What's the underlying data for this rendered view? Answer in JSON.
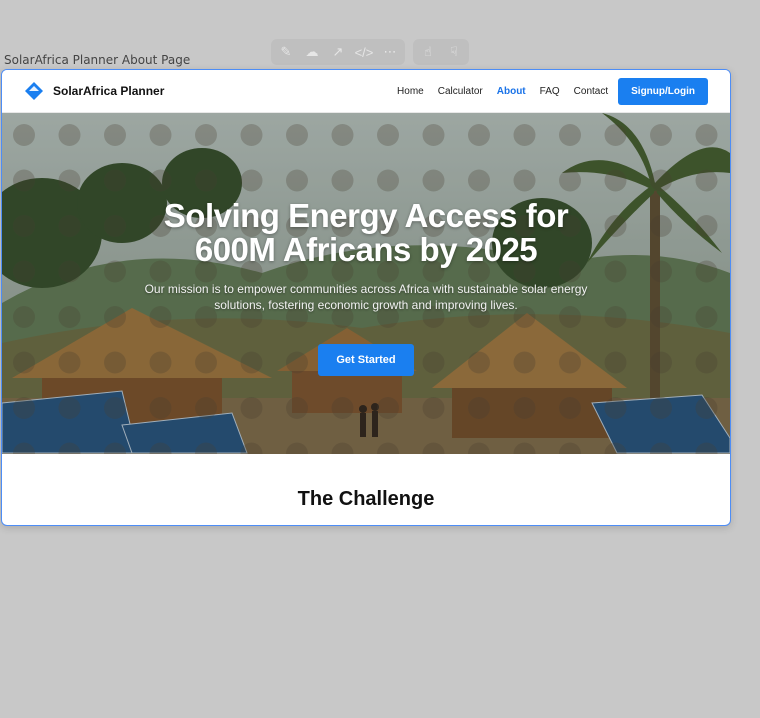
{
  "canvas": {
    "label": "SolarAfrica Planner About Page"
  },
  "toolbar": {
    "icons": [
      "eraser-icon",
      "cloud-icon",
      "expand-icon",
      "code-icon",
      "more-icon",
      "thumbs-up-icon",
      "thumbs-down-icon"
    ]
  },
  "nav": {
    "brand": "SolarAfrica Planner",
    "links": [
      "Home",
      "Calculator",
      "About",
      "FAQ",
      "Contact"
    ],
    "active": "About",
    "signup": "Signup/Login"
  },
  "hero": {
    "title": "Solving Energy Access for 600M Africans by 2025",
    "subtitle": "Our mission is to empower communities across Africa with sustainable solar energy solutions, fostering economic growth and improving lives.",
    "cta": "Get Started"
  },
  "challenge": {
    "title": "The Challenge"
  },
  "colors": {
    "accent": "#1a7ff0",
    "frame_border": "#4d8df6"
  }
}
